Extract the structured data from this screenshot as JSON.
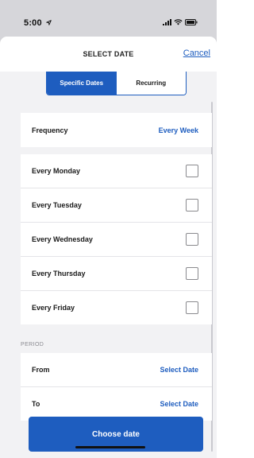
{
  "status": {
    "time": "5:00"
  },
  "header": {
    "title": "SELECT DATE",
    "cancel_label": "Cancel"
  },
  "tabs": [
    {
      "label": "Specific Dates",
      "active": true
    },
    {
      "label": "Recurring",
      "active": false
    }
  ],
  "frequency": {
    "label": "Frequency",
    "value": "Every Week"
  },
  "days": [
    {
      "label": "Every Monday",
      "checked": false
    },
    {
      "label": "Every Tuesday",
      "checked": false
    },
    {
      "label": "Every Wednesday",
      "checked": false
    },
    {
      "label": "Every Thursday",
      "checked": false
    },
    {
      "label": "Every Friday",
      "checked": false
    }
  ],
  "period": {
    "section_label": "PERIOD",
    "from_label": "From",
    "from_value": "Select Date",
    "to_label": "To",
    "to_value": "Select Date"
  },
  "footer": {
    "button_label": "Choose date"
  },
  "colors": {
    "accent": "#1e5dbf"
  }
}
